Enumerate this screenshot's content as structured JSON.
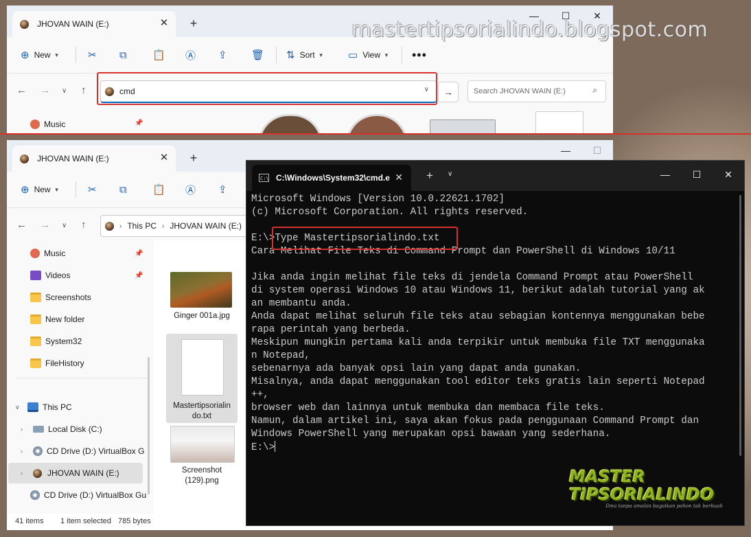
{
  "watermark": "mastertipsorialindo.blogspot.com",
  "explorer_top": {
    "tab_title": "JHOVAN WAIN (E:)",
    "toolbar": {
      "new": "New",
      "sort": "Sort",
      "view": "View"
    },
    "address_value": "cmd",
    "search_placeholder": "Search JHOVAN WAIN (E:)",
    "sidebar": [
      {
        "label": "Music"
      }
    ]
  },
  "explorer_bottom": {
    "tab_title": "JHOVAN WAIN (E:)",
    "toolbar": {
      "new": "New"
    },
    "breadcrumb": [
      "This PC",
      "JHOVAN WAIN (E:)"
    ],
    "sidebar": [
      {
        "label": "Music"
      },
      {
        "label": "Videos"
      },
      {
        "label": "Screenshots"
      },
      {
        "label": "New folder"
      },
      {
        "label": "System32"
      },
      {
        "label": "FileHistory"
      },
      {
        "label": "This PC"
      },
      {
        "label": "Local Disk (C:)"
      },
      {
        "label": "CD Drive (D:) VirtualBox G"
      },
      {
        "label": "JHOVAN WAIN (E:)"
      },
      {
        "label": "CD Drive (D:) VirtualBox Gu"
      }
    ],
    "files": [
      {
        "name": "Ginger 001a.jpg"
      },
      {
        "name": "Mastertipsorialindo.txt",
        "name_line1": "Mastertipsorialin",
        "name_line2": "do.txt"
      },
      {
        "name_line1": "Screenshot",
        "name_line2": "(129).png"
      }
    ],
    "status": {
      "items": "41 items",
      "selected": "1 item selected",
      "size": "785 bytes"
    }
  },
  "cmd": {
    "tab_title": "C:\\Windows\\System32\\cmd.e",
    "lines": [
      "Microsoft Windows [Version 10.0.22621.1702]",
      "(c) Microsoft Corporation. All rights reserved.",
      "",
      "E:\\>Type Mastertipsorialindo.txt",
      "Cara Melihat File Teks di Command Prompt dan PowerShell di Windows 10/11",
      "",
      "Jika anda ingin melihat file teks di jendela Command Prompt atau PowerShell",
      "di system operasi Windows 10 atau Windows 11, berikut adalah tutorial yang ak",
      "an membantu anda.",
      "Anda dapat melihat seluruh file teks atau sebagian kontennya menggunakan bebe",
      "rapa perintah yang berbeda.",
      "Meskipun mungkin pertama kali anda terpikir untuk membuka file TXT menggunaka",
      "n Notepad,",
      "sebenarnya ada banyak opsi lain yang dapat anda gunakan.",
      "Misalnya, anda dapat menggunakan tool editor teks gratis lain seperti Notepad",
      "++,",
      "browser web dan lainnya untuk membuka dan membaca file teks.",
      "Namun, dalam artikel ini, saya akan fokus pada penggunaan Command Prompt dan",
      "Windows PowerShell yang merupakan opsi bawaan yang sederhana."
    ],
    "prompt": "E:\\>"
  },
  "logo": {
    "line1": "MASTER",
    "line2": "TIPSORIALINDO",
    "tagline": "Ilmu tanpa amalan bagaikan pohon tak berbuah"
  },
  "colors": {
    "highlight_red": "#d9302c",
    "accent_blue": "#0067c0",
    "terminal_bg": "#0c0c0c"
  }
}
